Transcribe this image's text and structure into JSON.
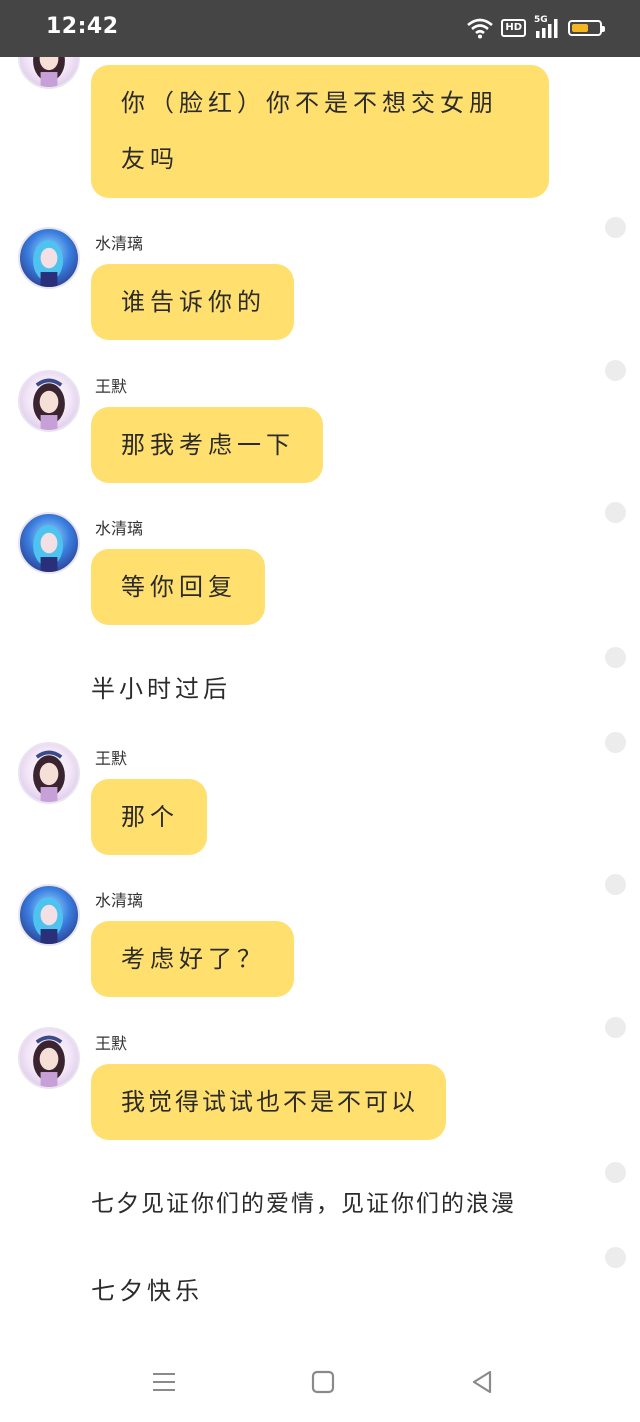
{
  "status_bar": {
    "time": "12:42",
    "hd_label": "HD",
    "network_label": "5G",
    "battery_level": 0.65,
    "battery_color": "#f2b623"
  },
  "colors": {
    "bubble": "#ffdf6e",
    "status_bar_bg": "#454545",
    "read_dot": "#ececec"
  },
  "messages": [
    {
      "type": "bubble",
      "sender": "",
      "avatar": "pink-girl-avatar",
      "text_lines": [
        "你（脸红）你不是不想交女朋",
        "友吗"
      ]
    },
    {
      "type": "bubble",
      "sender": "水清璃",
      "avatar": "blue-girl-avatar",
      "text": "谁告诉你的"
    },
    {
      "type": "bubble",
      "sender": "王默",
      "avatar": "pink-girl-avatar",
      "text": "那我考虑一下"
    },
    {
      "type": "bubble",
      "sender": "水清璃",
      "avatar": "blue-girl-avatar",
      "text": "等你回复"
    },
    {
      "type": "plain",
      "text": "半小时过后"
    },
    {
      "type": "bubble",
      "sender": "王默",
      "avatar": "pink-girl-avatar",
      "text": "那个"
    },
    {
      "type": "bubble",
      "sender": "水清璃",
      "avatar": "blue-girl-avatar",
      "text": "考虑好了？"
    },
    {
      "type": "bubble",
      "sender": "王默",
      "avatar": "pink-girl-avatar",
      "text": "我觉得试试也不是不可以"
    },
    {
      "type": "plain",
      "text": "七夕见证你们的爱情，见证你们的浪漫"
    },
    {
      "type": "plain",
      "text": "七夕快乐"
    }
  ],
  "nav_bar": {
    "icons": [
      "menu-icon",
      "home-square-icon",
      "back-triangle-icon"
    ]
  }
}
